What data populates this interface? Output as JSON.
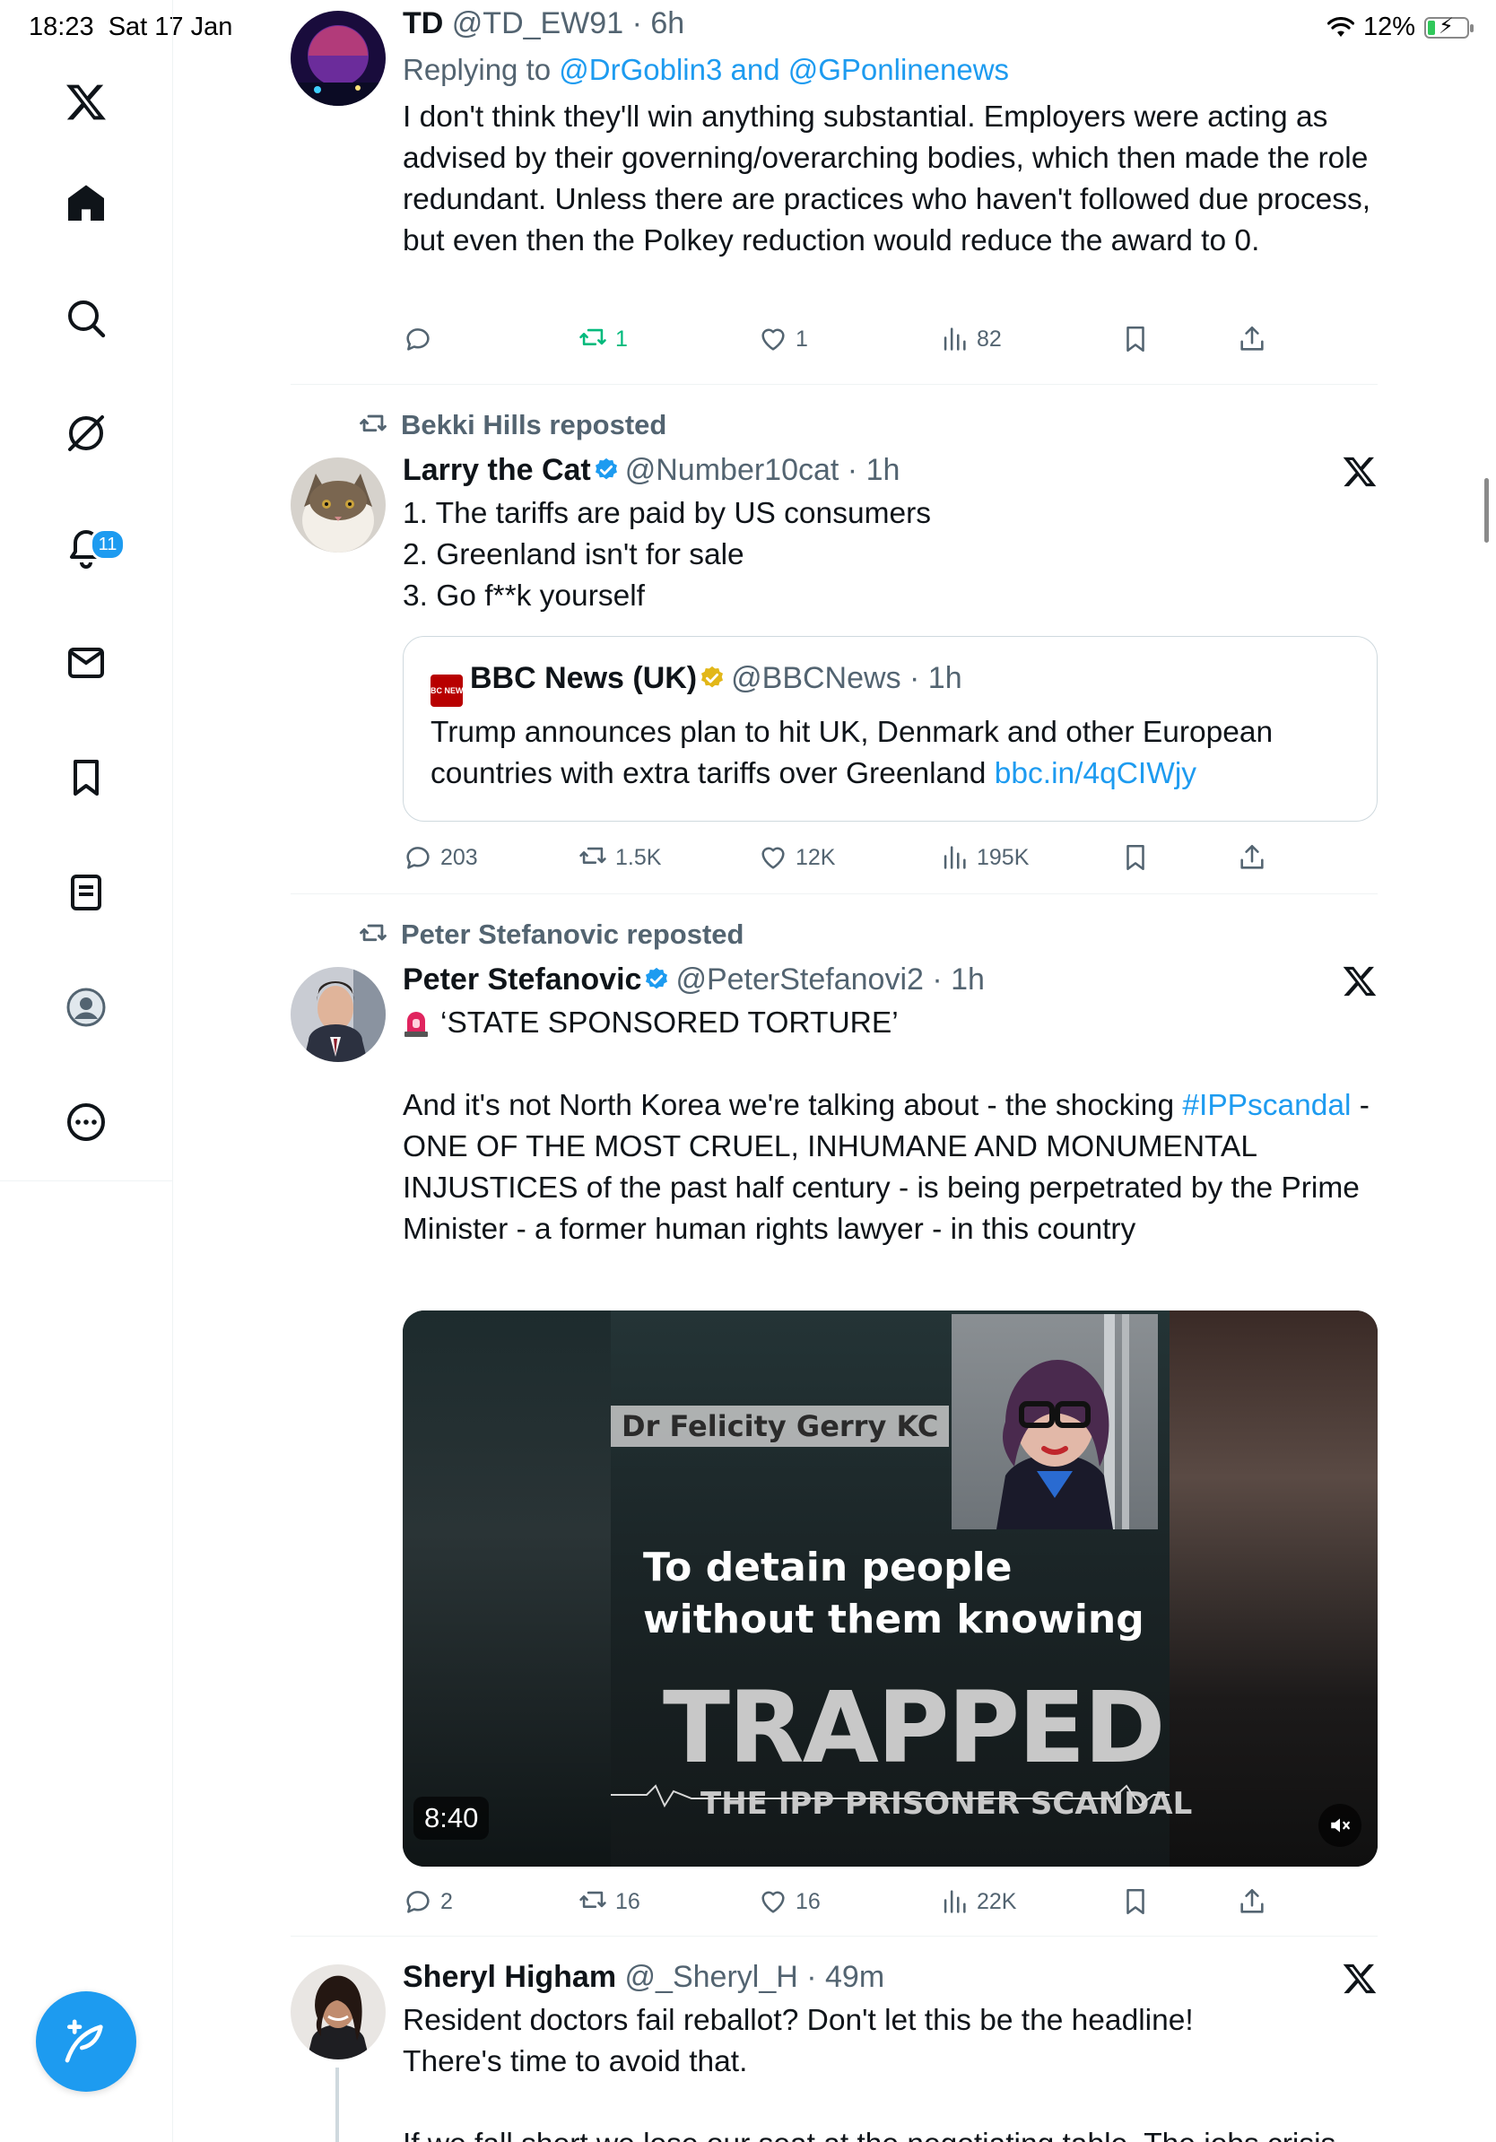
{
  "status_bar": {
    "time": "18:23",
    "date": "Sat 17 Jan",
    "battery": "12%"
  },
  "sidebar": {
    "notifications_badge": "11"
  },
  "tweets": [
    {
      "name": "TD",
      "handle": "@TD_EW91",
      "time": "6h",
      "replying_prefix": "Replying to",
      "replying_to": "@DrGoblin3 and @GPonlinenews",
      "text": "I don't think they'll win anything substantial. Employers were acting as advised by their governing/overarching bodies, which then made the role redundant. Unless there are practices who haven't followed due process, but even then the Polkey reduction would reduce the award to 0.",
      "retweets": "1",
      "likes": "1",
      "views": "82"
    },
    {
      "reposted_by": "Bekki Hills reposted",
      "name": "Larry the Cat",
      "handle": "@Number10cat",
      "time": "1h",
      "lines": [
        "1. The tariffs are paid by US consumers",
        "2. Greenland isn't for sale",
        "3. Go f**k yourself"
      ],
      "quote": {
        "logo_text": "BBC NEWS",
        "name": "BBC News (UK)",
        "handle": "@BBCNews",
        "time": "1h",
        "text": "Trump announces plan to hit UK, Denmark and other European countries with extra tariffs over Greenland",
        "link": "bbc.in/4qCIWjy"
      },
      "replies": "203",
      "retweets": "1.5K",
      "likes": "12K",
      "views": "195K"
    },
    {
      "reposted_by": "Peter Stefanovic reposted",
      "name": "Peter Stefanovic",
      "handle": "@PeterStefanovi2",
      "time": "1h",
      "line1": "‘STATE SPONSORED TORTURE’",
      "para_start": "And it's not North Korea we're talking about - the shocking",
      "hashtag": "#IPPscandal",
      "para_rest": " - ONE OF THE MOST CRUEL, INHUMANE AND MONUMENTAL INJUSTICES of the past half century - is being perpetrated by the Prime Minister - a former human rights lawyer - in this country",
      "video": {
        "name_caption": "Dr Felicity Gerry KC",
        "caption_line1": "To detain people",
        "caption_line2": "without them knowing",
        "title": "TRAPPED",
        "subtitle": "THE IPP PRISONER SCANDAL",
        "duration": "8:40"
      },
      "replies": "2",
      "retweets": "16",
      "likes": "16",
      "views": "22K"
    },
    {
      "name": "Sheryl Higham",
      "handle": "@_Sheryl_H",
      "time": "49m",
      "line1": "Resident doctors fail reballot? Don't let this be the headline!",
      "line2": "There's time to avoid that.",
      "line3": "If we fall short we lose our seat at the negotiating table. The jobs crisis"
    }
  ]
}
